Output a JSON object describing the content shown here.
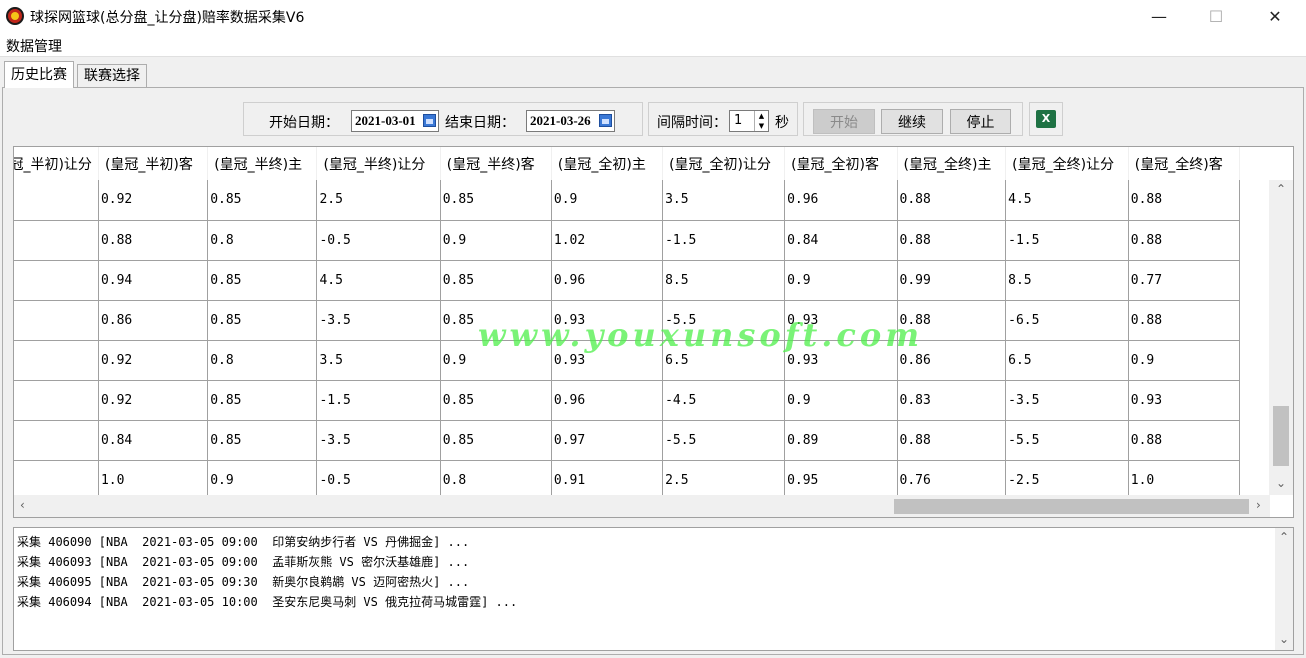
{
  "window": {
    "title": "球探网篮球(总分盘_让分盘)赔率数据采集V6",
    "minimize": "—",
    "maximize": "☐",
    "close": "✕"
  },
  "menu": {
    "items": [
      "数据管理"
    ]
  },
  "tabs": [
    "历史比赛",
    "联赛选择"
  ],
  "controls": {
    "start_date_label": "开始日期：",
    "start_date": "2021-03-01",
    "end_date_label": "结束日期：",
    "end_date": "2021-03-26",
    "interval_label": "间隔时间：",
    "interval_value": "1",
    "interval_unit": "秒",
    "start_button": "开始",
    "continue_button": "继续",
    "stop_button": "停止",
    "excel_icon": "excel-icon"
  },
  "grid": {
    "columns": [
      "(皇冠_半初)让分",
      "(皇冠_半初)客",
      "(皇冠_半终)主",
      "(皇冠_半终)让分",
      "(皇冠_半终)客",
      "(皇冠_全初)主",
      "(皇冠_全初)让分",
      "(皇冠_全初)客",
      "(皇冠_全终)主",
      "(皇冠_全终)让分",
      "(皇冠_全终)客"
    ],
    "rows": [
      [
        "",
        "0.92",
        "0.85",
        "2.5",
        "0.85",
        "0.9",
        "3.5",
        "0.96",
        "0.88",
        "4.5",
        "0.88"
      ],
      [
        "",
        "0.88",
        "0.8",
        "-0.5",
        "0.9",
        "1.02",
        "-1.5",
        "0.84",
        "0.88",
        "-1.5",
        "0.88"
      ],
      [
        "",
        "0.94",
        "0.85",
        "4.5",
        "0.85",
        "0.96",
        "8.5",
        "0.9",
        "0.99",
        "8.5",
        "0.77"
      ],
      [
        "",
        "0.86",
        "0.85",
        "-3.5",
        "0.85",
        "0.93",
        "-5.5",
        "0.93",
        "0.88",
        "-6.5",
        "0.88"
      ],
      [
        "",
        "0.92",
        "0.8",
        "3.5",
        "0.9",
        "0.93",
        "6.5",
        "0.93",
        "0.86",
        "6.5",
        "0.9"
      ],
      [
        "",
        "0.92",
        "0.85",
        "-1.5",
        "0.85",
        "0.96",
        "-4.5",
        "0.9",
        "0.83",
        "-3.5",
        "0.93"
      ],
      [
        "",
        "0.84",
        "0.85",
        "-3.5",
        "0.85",
        "0.97",
        "-5.5",
        "0.89",
        "0.88",
        "-5.5",
        "0.88"
      ],
      [
        "",
        "1.0",
        "0.9",
        "-0.5",
        "0.8",
        "0.91",
        "2.5",
        "0.95",
        "0.76",
        "-2.5",
        "1.0"
      ]
    ]
  },
  "log": [
    "采集 406090 [NBA  2021-03-05 09:00  印第安纳步行者 VS 丹佛掘金] ...",
    "采集 406093 [NBA  2021-03-05 09:00  孟菲斯灰熊 VS 密尔沃基雄鹿] ...",
    "采集 406095 [NBA  2021-03-05 09:30  新奥尔良鹈鹕 VS 迈阿密热火] ...",
    "采集 406094 [NBA  2021-03-05 10:00  圣安东尼奥马刺 VS 俄克拉荷马城雷霆] ..."
  ],
  "watermark": "www.youxunsoft.com"
}
